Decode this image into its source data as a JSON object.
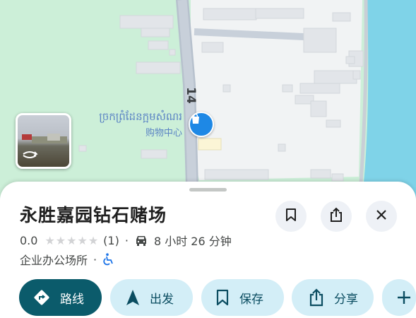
{
  "map": {
    "road_number": "14",
    "poi_name_khmer": "ច្រកព្រំដែនក្អមសំណរ",
    "poi_name_zh": "购物中心"
  },
  "place": {
    "title": "永胜嘉园钻石赌场",
    "rating": "0.0",
    "review_count": "(1)",
    "drive_time": "8 小时 26 分钟",
    "category": "企业办公场所"
  },
  "actions": {
    "route": "路线",
    "start": "出发",
    "save": "保存",
    "share": "分享"
  },
  "colors": {
    "primary": "#0b5b6b",
    "pill_bg": "#d3eef7",
    "water": "#7fd3e8",
    "park": "#ccefd8",
    "poi_blue": "#1e88e5"
  }
}
